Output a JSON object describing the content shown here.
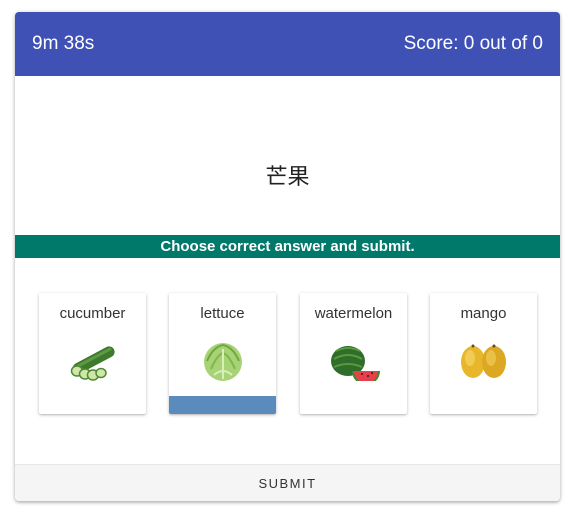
{
  "header": {
    "timer": "9m 38s",
    "score": "Score: 0 out of 0",
    "color": "#3f51b5"
  },
  "question": {
    "word": "芒果"
  },
  "banner": {
    "text": "Choose correct answer and submit.",
    "color": "#00796b"
  },
  "options": [
    {
      "label": "cucumber",
      "icon": "cucumber-icon",
      "selected": false
    },
    {
      "label": "lettuce",
      "icon": "lettuce-icon",
      "selected": true
    },
    {
      "label": "watermelon",
      "icon": "watermelon-icon",
      "selected": false
    },
    {
      "label": "mango",
      "icon": "mango-icon",
      "selected": false
    }
  ],
  "selection_color": "#5b8bbd",
  "submit": {
    "label": "SUBMIT"
  }
}
